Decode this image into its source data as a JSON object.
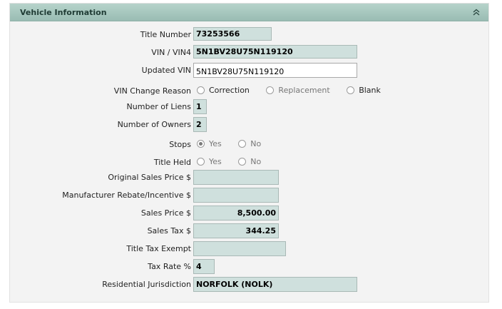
{
  "panel": {
    "title": "Vehicle Information",
    "collapse_icon": "double-chevron-up-icon"
  },
  "fields": {
    "title_number": {
      "label": "Title Number",
      "value": "73253566"
    },
    "vin": {
      "label": "VIN / VIN4",
      "value": "5N1BV28U75N119120"
    },
    "updated_vin": {
      "label": "Updated VIN",
      "value": "5N1BV28U75N119120"
    },
    "vin_change_reason": {
      "label": "VIN Change Reason",
      "options": [
        "Correction",
        "Replacement",
        "Blank"
      ]
    },
    "number_of_liens": {
      "label": "Number of Liens",
      "value": "1"
    },
    "number_of_owners": {
      "label": "Number of Owners",
      "value": "2"
    },
    "stops": {
      "label": "Stops",
      "options": [
        "Yes",
        "No"
      ],
      "selected": "Yes"
    },
    "title_held": {
      "label": "Title Held",
      "options": [
        "Yes",
        "No"
      ]
    },
    "original_sales_price": {
      "label": "Original Sales Price $",
      "value": ""
    },
    "manufacturer_rebate": {
      "label": "Manufacturer Rebate/Incentive $",
      "value": ""
    },
    "sales_price": {
      "label": "Sales Price $",
      "value": "8,500.00"
    },
    "sales_tax": {
      "label": "Sales Tax $",
      "value": "344.25"
    },
    "title_tax_exempt": {
      "label": "Title Tax Exempt",
      "value": ""
    },
    "tax_rate": {
      "label": "Tax Rate %",
      "value": "4"
    },
    "residential_jurisdiction": {
      "label": "Residential Jurisdiction",
      "value": "NORFOLK (NOLK)"
    }
  }
}
